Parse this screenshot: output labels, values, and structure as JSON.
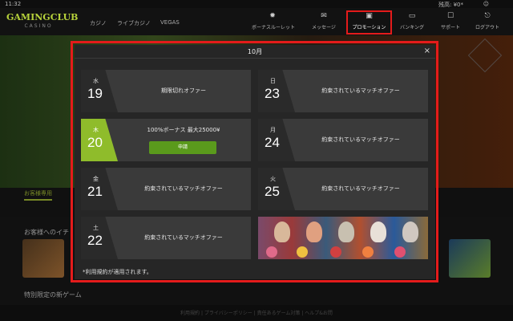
{
  "status": {
    "time": "11:32",
    "balance": "残高: ¥0*"
  },
  "header": {
    "logo_main": "GAMINGCLUB",
    "logo_sub": "CASINO",
    "tabs": [
      "カジノ",
      "ライブカジノ",
      "VEGAS"
    ],
    "nav": [
      {
        "label": "ボーナスルーレット",
        "icon": "roulette-icon",
        "glyph": "✹"
      },
      {
        "label": "メッセージ",
        "icon": "mail-icon",
        "glyph": "✉"
      },
      {
        "label": "プロモーション",
        "icon": "calendar-icon",
        "glyph": "▣"
      },
      {
        "label": "バンキング",
        "icon": "wallet-icon",
        "glyph": "▭"
      },
      {
        "label": "サポート",
        "icon": "chat-icon",
        "glyph": "☐"
      },
      {
        "label": "ログアウト",
        "icon": "logout-icon",
        "glyph": "⎋"
      }
    ]
  },
  "background": {
    "tab_label": "お客様専用",
    "section1": "お客様へのイチ",
    "section2": "特別限定の新ゲーム",
    "footer": "利用規約 | プライバシーポリシー | 責任あるゲーム対策 | ヘルプ&お問"
  },
  "modal": {
    "title": "10月",
    "close": "×",
    "cards": [
      {
        "dow": "水",
        "day": "19",
        "title": "期限切れオファー"
      },
      {
        "dow": "日",
        "day": "23",
        "title": "約束されているマッチオファー"
      },
      {
        "dow": "木",
        "day": "20",
        "title": "100%ボーナス 最大25000¥",
        "button": "申請",
        "today": true
      },
      {
        "dow": "月",
        "day": "24",
        "title": "約束されているマッチオファー"
      },
      {
        "dow": "金",
        "day": "21",
        "title": "約束されているマッチオファー"
      },
      {
        "dow": "火",
        "day": "25",
        "title": "約束されているマッチオファー"
      },
      {
        "dow": "土",
        "day": "22",
        "title": "約束されているマッチオファー"
      }
    ],
    "disclaimer": "*利用規約が適用されます。"
  },
  "colors": {
    "accent": "#8fbc2b",
    "highlight": "#e41b1b",
    "button": "#5a9a1c"
  }
}
